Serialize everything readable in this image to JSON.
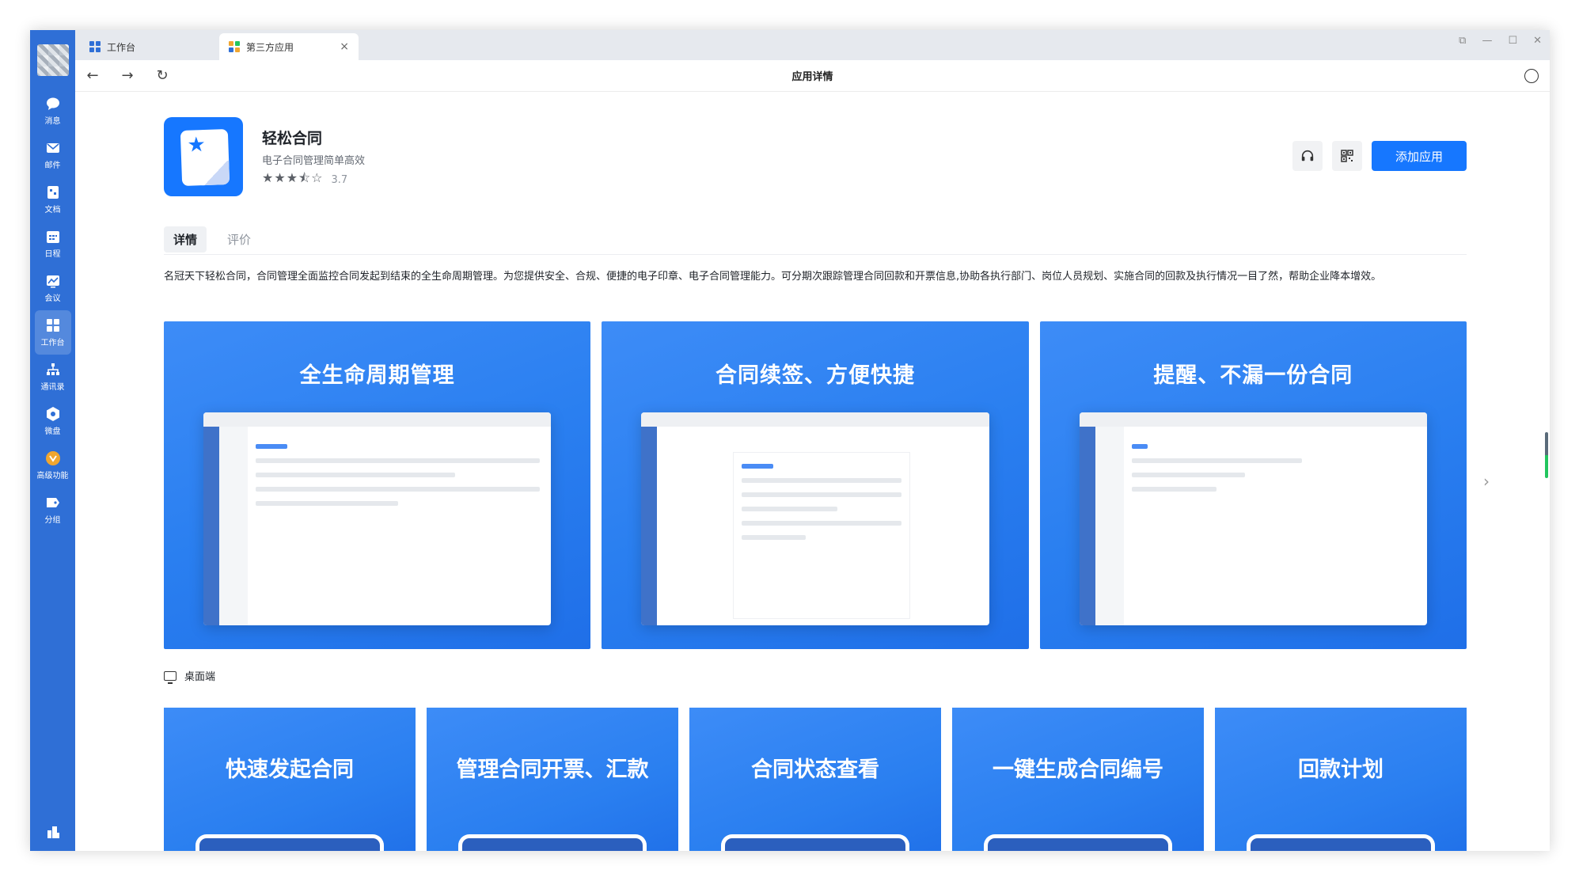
{
  "window": {
    "tabs": [
      {
        "label": "工作台"
      },
      {
        "label": "第三方应用",
        "close": "×"
      }
    ],
    "page_title": "应用详情"
  },
  "sidebar": {
    "items": [
      {
        "label": "消息",
        "icon": "chat-bubble-icon"
      },
      {
        "label": "邮件",
        "icon": "mail-icon"
      },
      {
        "label": "文档",
        "icon": "document-icon"
      },
      {
        "label": "日程",
        "icon": "calendar-icon"
      },
      {
        "label": "会议",
        "icon": "meeting-icon"
      },
      {
        "label": "工作台",
        "icon": "workbench-grid-icon",
        "active": true
      },
      {
        "label": "通讯录",
        "icon": "contacts-org-icon"
      },
      {
        "label": "微盘",
        "icon": "drive-icon"
      },
      {
        "label": "高级功能",
        "icon": "advanced-features-icon"
      },
      {
        "label": "分组",
        "icon": "group-tag-icon"
      }
    ]
  },
  "app": {
    "name": "轻松合同",
    "subtitle": "电子合同管理简单高效",
    "rating_value": "3.7",
    "rating_stars": 3.5,
    "add_button": "添加应用"
  },
  "detail_tabs": [
    {
      "label": "详情",
      "active": true
    },
    {
      "label": "评价"
    }
  ],
  "intro": "名冠天下轻松合同，合同管理全面监控合同发起到结束的全生命周期管理。为您提供安全、合规、便捷的电子印章、电子合同管理能力。可分期次跟踪管理合同回款和开票信息,协助各执行部门、岗位人员规划、实施合同的回款及执行情况一目了然，帮助企业降本增效。",
  "screenshots": [
    {
      "title": "全生命周期管理"
    },
    {
      "title": "合同续签、方便快捷"
    },
    {
      "title": "提醒、不漏一份合同"
    }
  ],
  "platform_label": "桌面端",
  "mobile_cards": [
    {
      "title": "快速发起合同"
    },
    {
      "title": "管理合同开票、汇款"
    },
    {
      "title": "合同状态查看"
    },
    {
      "title": "一键生成合同编号"
    },
    {
      "title": "回款计划"
    }
  ],
  "colors": {
    "sidebar": "#2f6fd6",
    "primary": "#1677ff"
  }
}
